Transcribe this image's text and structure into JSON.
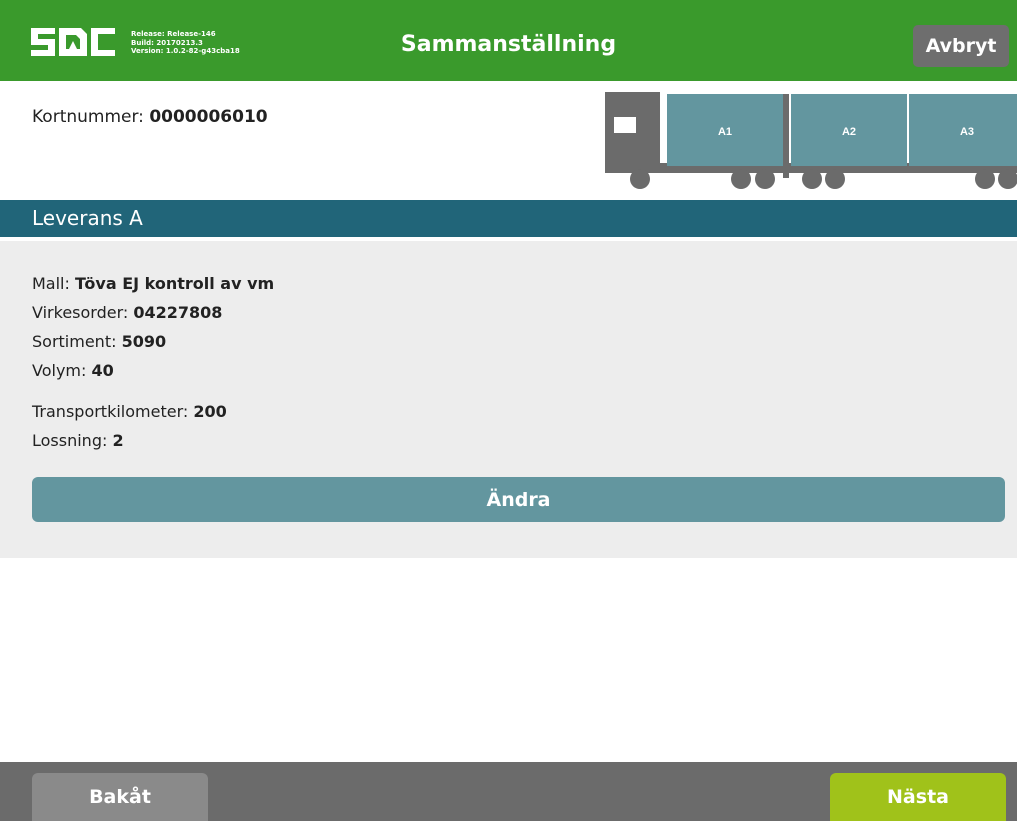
{
  "header": {
    "logo_text": "SDC",
    "release": "Release: Release-146",
    "build": "Build: 20170213.3",
    "version": "Version: 1.0.2-82-g43cba18",
    "title": "Sammanställning",
    "cancel_label": "Avbryt"
  },
  "card": {
    "label": "Kortnummer: ",
    "value": "0000006010"
  },
  "truck": {
    "compartments": [
      "A1",
      "A2",
      "A3"
    ]
  },
  "delivery": {
    "heading": "Leverans A",
    "fields": [
      {
        "label": "Mall: ",
        "value": "Töva EJ kontroll av vm"
      },
      {
        "label": "Virkesorder: ",
        "value": "04227808"
      },
      {
        "label": "Sortiment: ",
        "value": "5090"
      },
      {
        "label": "Volym: ",
        "value": "40"
      }
    ],
    "fields2": [
      {
        "label": "Transportkilometer: ",
        "value": "200"
      },
      {
        "label": "Lossning: ",
        "value": "2"
      }
    ],
    "edit_label": "Ändra"
  },
  "footer": {
    "back_label": "Bakåt",
    "next_label": "Nästa"
  },
  "colors": {
    "header": "#3a9a2c",
    "section": "#216579",
    "edit_button": "#63969f",
    "next_button": "#a0c21a",
    "footer": "#6b6b6b"
  }
}
